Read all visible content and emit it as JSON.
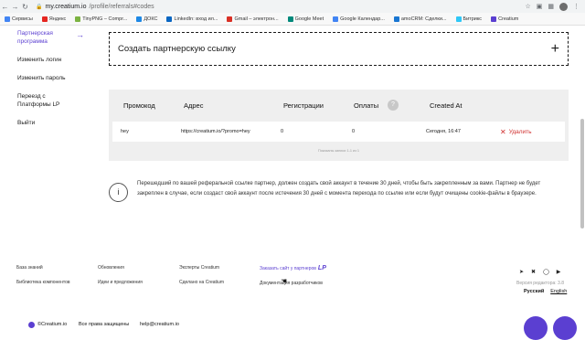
{
  "browser": {
    "back_icon": "arrow-left-icon",
    "forward_icon": "arrow-right-icon",
    "reload_icon": "reload-icon",
    "url_host": "my.creatium.io",
    "url_path": "/profile/referrals#codes"
  },
  "bookmarks": [
    {
      "label": "Сервисы",
      "color": "#4285f4"
    },
    {
      "label": "Яндекс",
      "color": "#e52620"
    },
    {
      "label": "TinyPNG – Compr...",
      "color": "#7cb342"
    },
    {
      "label": "ДОКС",
      "color": "#1e88e5"
    },
    {
      "label": "LinkedIn: вход ил...",
      "color": "#0a66c2"
    },
    {
      "label": "Gmail – электрон...",
      "color": "#d93025"
    },
    {
      "label": "Google Meet",
      "color": "#00897b"
    },
    {
      "label": "Google Календар...",
      "color": "#4285f4"
    },
    {
      "label": "amoCRM: Сделки...",
      "color": "#1976d2"
    },
    {
      "label": "Битрикс",
      "color": "#2fc7f7"
    },
    {
      "label": "Creatium",
      "color": "#5b3fd1"
    }
  ],
  "sidebar": {
    "items": [
      {
        "label": "Партнерская программа",
        "active": true
      },
      {
        "label": "Изменить логин"
      },
      {
        "label": "Изменить пароль"
      },
      {
        "label": "Переезд с Платформы LP"
      },
      {
        "label": "Выйти"
      }
    ]
  },
  "create_link": {
    "label": "Создать партнерскую ссылку"
  },
  "table": {
    "headers": [
      "Промокод",
      "Адрес",
      "Регистрации",
      "Оплаты",
      "Created At"
    ],
    "header_badge": "?",
    "rows": [
      {
        "promo": "hey",
        "address": "https://creatium.io/?promo=hey",
        "registrations": "0",
        "payments": "0",
        "created_at": "Сегодня, 16:47",
        "delete_label": "Удалить"
      }
    ],
    "footer": "Показаны записи 1-1 из 1"
  },
  "info": {
    "text": "Перешедший по вашей реферальной ссылке партнер, должен создать свой аккаунт в течение 30 дней, чтобы быть закрепленным за вами. Партнер не будет закреплен в случае, если создаст свой аккаунт после истечения 30 дней с момента перехода по ссылке или если будут очищены cookie-файлы в браузере."
  },
  "footer": {
    "col1": [
      "База знаний",
      "Библиотека компонентов"
    ],
    "col2": [
      "Обновления",
      "Идеи и предложения"
    ],
    "col3": [
      "Эксперты Creatium",
      "Сделано на Creatium"
    ],
    "col4": [
      "Заказать сайт у партнеров",
      "Документация разработчиков"
    ],
    "lp_badge": "LP",
    "version": "Версия редактора: 3.8",
    "lang_active": "Русский",
    "lang_other": "English"
  },
  "bottom": {
    "brand": "©Creatium.io",
    "rights": "Все права защищены",
    "email": "help@creatium.io"
  },
  "colors": {
    "accent": "#5b3fd1",
    "danger": "#d0302f"
  }
}
